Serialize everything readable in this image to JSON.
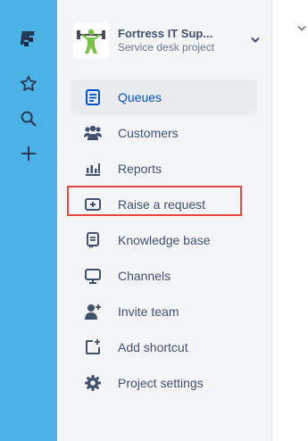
{
  "rail": {
    "icons": [
      "jira-logo-icon",
      "star-icon",
      "search-icon",
      "plus-icon"
    ]
  },
  "project": {
    "name": "Fortress IT Sup...",
    "type": "Service desk project"
  },
  "nav": {
    "items": [
      {
        "label": "Queues",
        "icon": "queues-icon",
        "active": true
      },
      {
        "label": "Customers",
        "icon": "customers-icon"
      },
      {
        "label": "Reports",
        "icon": "reports-icon"
      },
      {
        "label": "Raise a request",
        "icon": "raise-request-icon",
        "highlighted": true
      },
      {
        "label": "Knowledge base",
        "icon": "knowledge-base-icon"
      },
      {
        "label": "Channels",
        "icon": "channels-icon"
      },
      {
        "label": "Invite team",
        "icon": "invite-team-icon"
      },
      {
        "label": "Add shortcut",
        "icon": "add-shortcut-icon"
      },
      {
        "label": "Project settings",
        "icon": "gear-icon"
      }
    ]
  },
  "colors": {
    "rail": "#4bb3e6",
    "sidebar": "#f4f5f7",
    "active_text": "#0052cc",
    "text": "#42526e",
    "highlight": "#e5493a"
  }
}
